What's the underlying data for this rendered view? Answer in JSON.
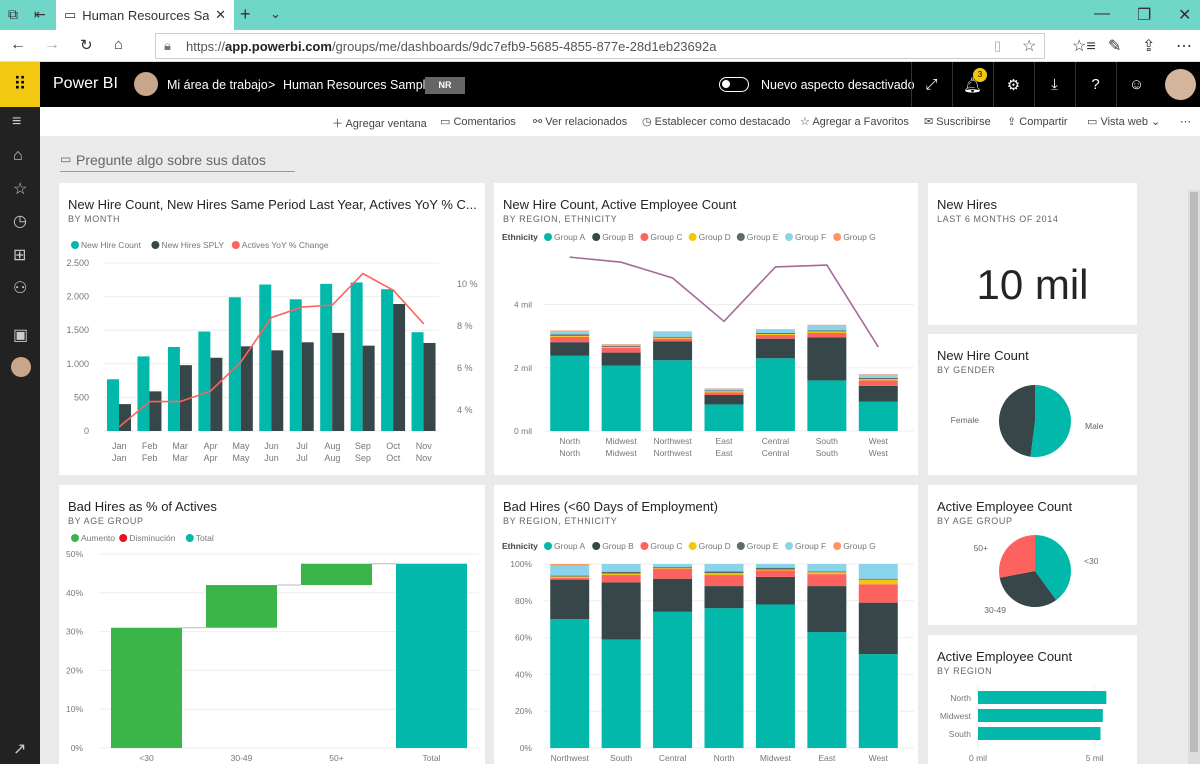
{
  "browser": {
    "tab_title": "Human Resources Samp",
    "url_prefix": "https://",
    "url_host": "app.powerbi.com",
    "url_path": "/groups/me/dashboards/9dc7efb9-5685-4855-877e-28d1eb23692a"
  },
  "header": {
    "app": "Power BI",
    "workspace": "Mi área de trabajo",
    "separator": ">",
    "dashboard": "Human Resources Sample",
    "badge": "NR",
    "toggle_label": "Nuevo aspecto desactivado",
    "notifications": "3"
  },
  "toolbar": [
    "Agregar ventana",
    "Comentarios",
    "Ver relacionados",
    "Establecer como destacado",
    "Agregar a Favoritos",
    "Suscribirse",
    "Compartir",
    "Vista web"
  ],
  "qa_placeholder": "Pregunte algo sobre sus datos",
  "colors": {
    "teal": "#01b8aa",
    "dark": "#374649",
    "red": "#fd625e",
    "yellow": "#f2c80f",
    "gray": "#5f6b6d",
    "lightblue": "#8ad4eb",
    "orange": "#fe9666",
    "purple": "#a66999",
    "green": "#3bb44a"
  },
  "tiles": {
    "t1": {
      "title": "New Hire Count, New Hires Same Period Last Year, Actives YoY % C...",
      "subtitle": "BY MONTH"
    },
    "t2": {
      "title": "New Hire Count, Active Employee Count",
      "subtitle": "BY REGION, ETHNICITY"
    },
    "t3": {
      "title": "New Hires",
      "subtitle": "LAST 6 MONTHS OF 2014",
      "value": "10 mil"
    },
    "t4": {
      "title": "New Hire Count",
      "subtitle": "BY GENDER"
    },
    "t5": {
      "title": "Bad Hires as % of Actives",
      "subtitle": "BY AGE GROUP"
    },
    "t6": {
      "title": "Bad Hires (<60 Days of Employment)",
      "subtitle": "BY REGION, ETHNICITY"
    },
    "t7": {
      "title": "Active Employee Count",
      "subtitle": "BY AGE GROUP"
    },
    "t8": {
      "title": "Active Employee Count",
      "subtitle": "BY REGION"
    }
  },
  "chart_data": [
    {
      "type": "bar",
      "id": "monthly",
      "categories": [
        "Jan Jan",
        "Feb Feb",
        "Mar Mar",
        "Apr Apr",
        "May May",
        "Jun Jun",
        "Jul Jul",
        "Aug Aug",
        "Sep Sep",
        "Oct Oct",
        "Nov Nov"
      ],
      "series": [
        {
          "name": "New Hire Count",
          "values": [
            770,
            1110,
            1250,
            1480,
            1990,
            2180,
            1960,
            2190,
            2210,
            2110,
            1470
          ]
        },
        {
          "name": "New Hires SPLY",
          "values": [
            400,
            590,
            980,
            1090,
            1260,
            1200,
            1320,
            1460,
            1270,
            1890,
            1310
          ]
        },
        {
          "name": "Actives YoY % Change",
          "type": "line",
          "axis": "right",
          "values": [
            3.2,
            4.4,
            4.4,
            4.9,
            6.3,
            8.4,
            8.9,
            9.0,
            10.5,
            9.7,
            8.1
          ]
        }
      ],
      "yticks": [
        "0",
        "500",
        "1.000",
        "1.500",
        "2.000",
        "2.500"
      ],
      "ylim": [
        0,
        2500
      ],
      "y2ticks": [
        "4 %",
        "6 %",
        "8 %",
        "10 %"
      ],
      "y2lim": [
        3,
        11
      ],
      "legend": "top-left",
      "grid": true
    },
    {
      "type": "bar",
      "id": "region",
      "stacked": true,
      "legend_title": "Ethnicity",
      "categories": [
        "North North",
        "Midwest Midwest",
        "Northwest Northwest",
        "East East",
        "Central Central",
        "South South",
        "West West"
      ],
      "series": [
        {
          "name": "Group A",
          "values": [
            2.38,
            2.07,
            2.24,
            0.84,
            2.3,
            1.6,
            0.93
          ]
        },
        {
          "name": "Group B",
          "values": [
            0.43,
            0.41,
            0.6,
            0.3,
            0.62,
            1.36,
            0.5
          ]
        },
        {
          "name": "Group C",
          "values": [
            0.17,
            0.15,
            0.08,
            0.08,
            0.12,
            0.14,
            0.17
          ]
        },
        {
          "name": "Group D",
          "values": [
            0.03,
            0.03,
            0.03,
            0.04,
            0.03,
            0.05,
            0.04
          ]
        },
        {
          "name": "Group E",
          "values": [
            0.05,
            0.03,
            0.03,
            0.02,
            0.03,
            0.03,
            0.04
          ]
        },
        {
          "name": "Group F",
          "values": [
            0.1,
            0.04,
            0.15,
            0.06,
            0.1,
            0.16,
            0.1
          ]
        },
        {
          "name": "Group G",
          "values": [
            0.02,
            0.02,
            0.02,
            0.01,
            0.02,
            0.02,
            0.02
          ]
        }
      ],
      "line": {
        "type": "line",
        "values": [
          5.5,
          5.34,
          4.84,
          3.47,
          5.19,
          5.25,
          2.66
        ]
      },
      "yticks": [
        "0 mil",
        "2 mil",
        "4 mil"
      ],
      "ylim": [
        0,
        6.2
      ],
      "legend": "top-left",
      "grid": true
    },
    {
      "type": "pie",
      "id": "gender",
      "labels": [
        "Male",
        "Female"
      ],
      "values": [
        52,
        48
      ]
    },
    {
      "type": "bar",
      "id": "waterfall",
      "subtype": "waterfall",
      "legend": [
        "Aumento",
        "Disminución",
        "Total"
      ],
      "categories": [
        "<30",
        "30-49",
        "50+",
        "Total"
      ],
      "values": [
        31,
        11,
        5.5,
        47.5
      ],
      "yticks": [
        "0%",
        "10%",
        "20%",
        "30%",
        "40%",
        "50%"
      ],
      "ylim": [
        0,
        50
      ]
    },
    {
      "type": "bar",
      "id": "badhires",
      "stacked": true,
      "percent": true,
      "legend_title": "Ethnicity",
      "categories": [
        "Northwest",
        "South",
        "Central",
        "North",
        "Midwest",
        "East",
        "West"
      ],
      "series": [
        {
          "name": "Group A",
          "values": [
            70,
            59,
            74,
            76,
            78,
            63,
            51
          ]
        },
        {
          "name": "Group B",
          "values": [
            21.5,
            31,
            18,
            12,
            15,
            25,
            28
          ]
        },
        {
          "name": "Group C",
          "values": [
            1,
            4,
            5.5,
            6,
            3.5,
            6.5,
            10
          ]
        },
        {
          "name": "Group D",
          "values": [
            0.7,
            0.8,
            0.3,
            1,
            0.5,
            1,
            2.5
          ]
        },
        {
          "name": "Group E",
          "values": [
            0.5,
            1,
            0.5,
            1,
            1,
            0.5,
            0.5
          ]
        },
        {
          "name": "Group F",
          "values": [
            5.3,
            4.2,
            1.7,
            4,
            2,
            4,
            8
          ]
        },
        {
          "name": "Group G",
          "values": [
            1,
            0,
            0,
            0,
            0,
            0,
            0
          ]
        }
      ],
      "yticks": [
        "0%",
        "20%",
        "40%",
        "60%",
        "80%",
        "100%"
      ],
      "ylim": [
        0,
        100
      ]
    },
    {
      "type": "pie",
      "id": "age",
      "labels": [
        "<30",
        "30-49",
        "50+"
      ],
      "values": [
        40,
        32,
        28
      ]
    },
    {
      "type": "bar",
      "id": "regionbar",
      "orientation": "horizontal",
      "categories": [
        "North",
        "Midwest",
        "South"
      ],
      "values": [
        5.5,
        5.35,
        5.25
      ],
      "xticks": [
        "0 mil",
        "5 mil"
      ],
      "xlim": [
        0,
        6
      ]
    }
  ]
}
